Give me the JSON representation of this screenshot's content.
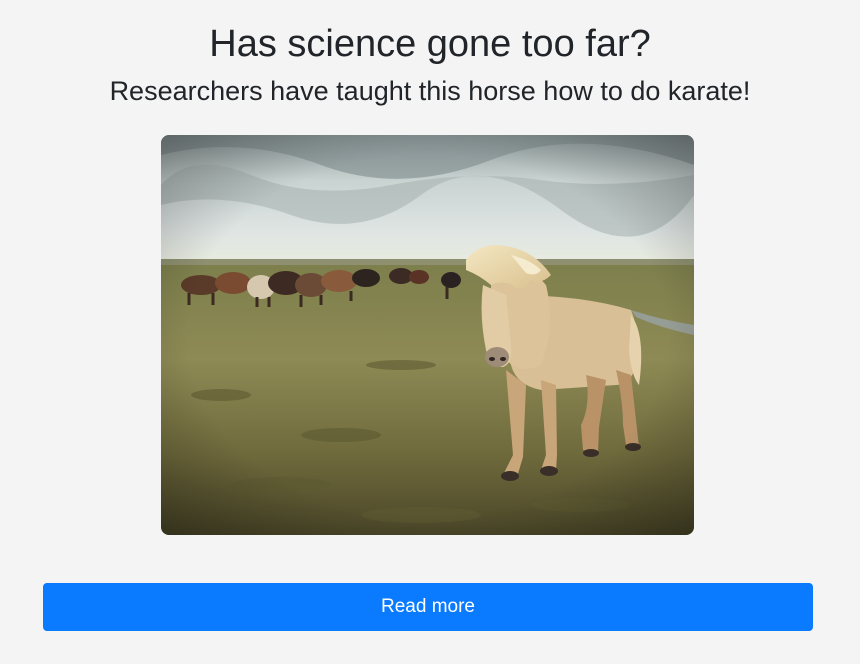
{
  "article": {
    "title": "Has science gone too far?",
    "subtitle": "Researchers have taught this horse how to do karate!",
    "read_more_label": "Read more"
  },
  "colors": {
    "background": "#f4f4f4",
    "button": "#0a7bff",
    "button_text": "#ffffff",
    "heading": "#212529"
  }
}
